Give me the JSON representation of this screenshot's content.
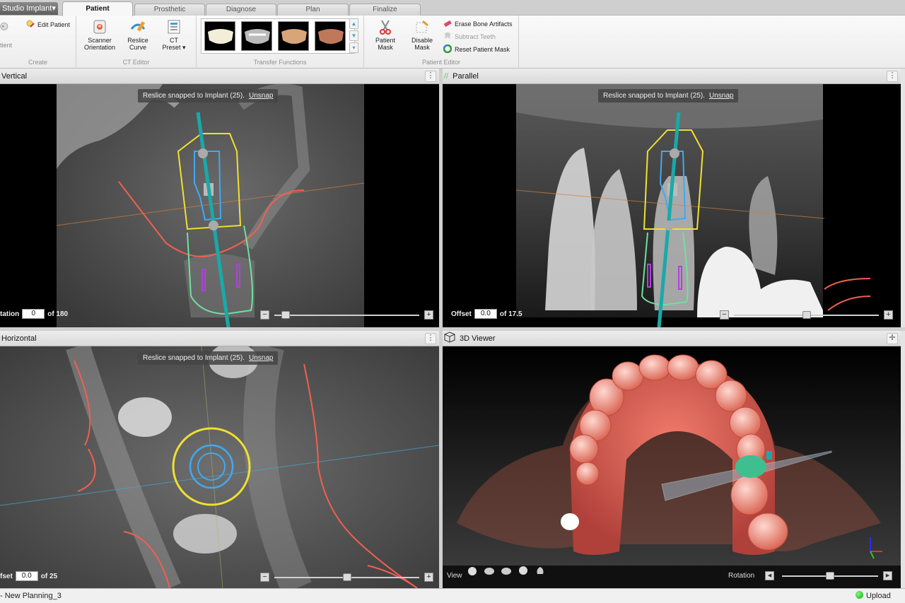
{
  "app_menu": "Studio Implant",
  "tabs": [
    "Patient",
    "Prosthetic",
    "Diagnose",
    "Plan",
    "Finalize"
  ],
  "ribbon": {
    "create": {
      "label": "Create",
      "partial": "tient",
      "edit_patient": "Edit Patient"
    },
    "ct_editor": {
      "label": "CT Editor",
      "scanner_orientation": [
        "Scanner",
        "Orientation"
      ],
      "reslice_curve": [
        "Reslice",
        "Curve"
      ],
      "ct_preset": [
        "CT",
        "Preset"
      ]
    },
    "transfer_functions": {
      "label": "Transfer Functions"
    },
    "patient_editor": {
      "label": "Patient Editor",
      "patient_mask": [
        "Patient",
        "Mask"
      ],
      "disable_mask": [
        "Disable",
        "Mask"
      ],
      "erase_bone": "Erase Bone Artifacts",
      "subtract_teeth": "Subtract Teeth",
      "reset_mask": "Reset Patient Mask"
    }
  },
  "panels": {
    "vertical": {
      "title": "Vertical",
      "snap": "Reslice snapped to Implant (25).",
      "unsnap": "Unsnap",
      "ctrl_label": "tation",
      "ctrl_value": "0",
      "ctrl_of": "of 180",
      "slider": 0.05
    },
    "parallel": {
      "title": "Parallel",
      "snap": "Reslice snapped to Implant (25).",
      "unsnap": "Unsnap",
      "ctrl_label": "Offset",
      "ctrl_value": "0.0",
      "ctrl_of": "of 17.5",
      "slider": 0.5
    },
    "horizontal": {
      "title": "Horizontal",
      "snap": "Reslice snapped to Implant (25).",
      "unsnap": "Unsnap",
      "ctrl_label": "fset",
      "ctrl_value": "0.0",
      "ctrl_of": "of 25",
      "slider": 0.5
    },
    "viewer3d": {
      "title": "3D Viewer",
      "view_label": "View",
      "rotation_label": "Rotation",
      "slider": 0.5
    }
  },
  "footer": {
    "planning": "- New Planning_3",
    "status": "Upload Cen"
  },
  "colors": {
    "implant": "#3fa9f5",
    "axis": "#1aa9a9",
    "zone": "#f0e030",
    "nerve": "#f06050",
    "crown": "#70e0a0",
    "pin": "#b040e0"
  }
}
